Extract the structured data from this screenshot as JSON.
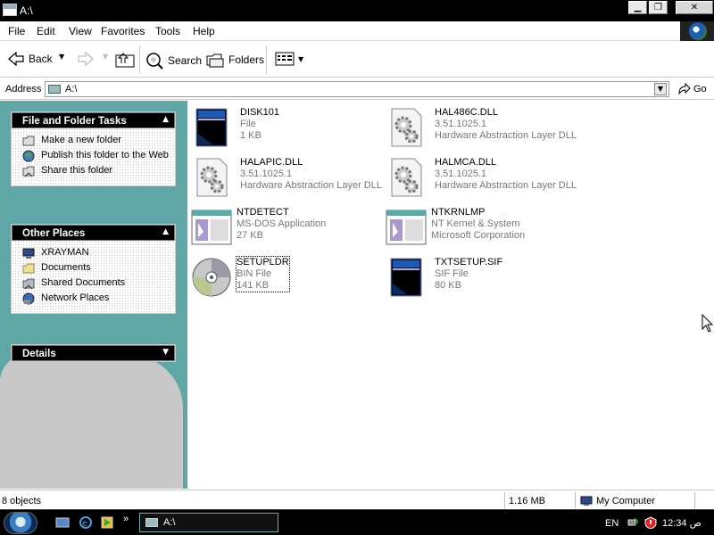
{
  "window": {
    "title": "A:\\"
  },
  "window_buttons": {
    "minimize": "▁",
    "maximize": "❐",
    "close": "✕"
  },
  "menu": {
    "file": "File",
    "edit": "Edit",
    "view": "View",
    "favorites": "Favorites",
    "tools": "Tools",
    "help": "Help"
  },
  "toolbar": {
    "back": "Back",
    "search": "Search",
    "folders": "Folders"
  },
  "address": {
    "label": "Address",
    "value": "A:\\",
    "go": "Go"
  },
  "tasks_panel": {
    "title": "File and Folder Tasks",
    "items": [
      "Make a new folder",
      "Publish this folder to the Web",
      "Share this folder"
    ]
  },
  "places_panel": {
    "title": "Other Places",
    "items": [
      "XRAYMAN",
      "Documents",
      "Shared Documents",
      "Network Places"
    ]
  },
  "details_panel": {
    "title": "Details"
  },
  "files": [
    {
      "name": "DISK101",
      "line2": "File",
      "line3": "1 KB",
      "icon": "file-icon"
    },
    {
      "name": "HAL486C.DLL",
      "line2": "3.51.1025.1",
      "line3": "Hardware Abstraction Layer DLL",
      "icon": "dll-gear-icon"
    },
    {
      "name": "HALAPIC.DLL",
      "line2": "3.51.1025.1",
      "line3": "Hardware Abstraction Layer DLL",
      "icon": "dll-gear-icon"
    },
    {
      "name": "HALMCA.DLL",
      "line2": "3.51.1025.1",
      "line3": "Hardware Abstraction Layer DLL",
      "icon": "dll-gear-icon"
    },
    {
      "name": "NTDETECT",
      "line2": "MS-DOS Application",
      "line3": "27 KB",
      "icon": "application-icon"
    },
    {
      "name": "NTKRNLMP",
      "line2": "NT Kernel & System",
      "line3": "Microsoft Corporation",
      "icon": "application-icon"
    },
    {
      "name": "SETUPLDR",
      "line2": "BIN File",
      "line3": "141 KB",
      "icon": "cd-icon"
    },
    {
      "name": "TXTSETUP.SIF",
      "line2": "SIF File",
      "line3": "80 KB",
      "icon": "file-icon"
    }
  ],
  "status": {
    "objects": "8 objects",
    "size": "1.16 MB",
    "location": "My Computer"
  },
  "taskbar": {
    "task": "A:\\",
    "chevron": "»",
    "lang": "EN",
    "clock": "12:34 ص"
  }
}
